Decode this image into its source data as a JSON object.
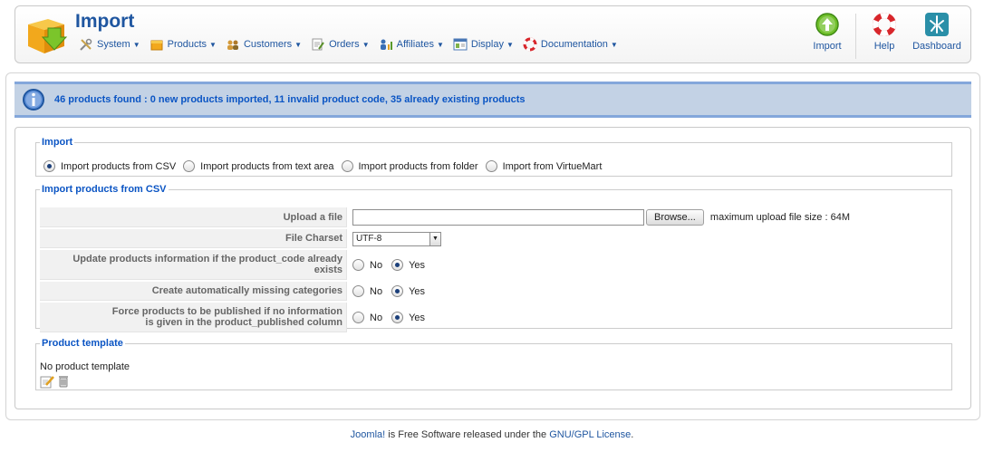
{
  "header": {
    "title": "Import",
    "menu": [
      {
        "label": "System",
        "icon": "wrench-screwdriver-icon"
      },
      {
        "label": "Products",
        "icon": "box-icon"
      },
      {
        "label": "Customers",
        "icon": "users-icon"
      },
      {
        "label": "Orders",
        "icon": "document-pen-icon"
      },
      {
        "label": "Affiliates",
        "icon": "people-chart-icon"
      },
      {
        "label": "Display",
        "icon": "window-icon"
      },
      {
        "label": "Documentation",
        "icon": "lifebuoy-icon"
      }
    ],
    "toolbar": {
      "import_label": "Import",
      "help_label": "Help",
      "dashboard_label": "Dashboard"
    }
  },
  "message": {
    "text": "46 products found : 0 new products imported, 11 invalid product code, 35 already existing products"
  },
  "import_section": {
    "legend": "Import",
    "options": [
      {
        "label": "Import products from CSV",
        "selected": true
      },
      {
        "label": "Import products from text area",
        "selected": false
      },
      {
        "label": "Import products from folder",
        "selected": false
      },
      {
        "label": "Import from VirtueMart",
        "selected": false
      }
    ]
  },
  "csv_section": {
    "legend": "Import products from CSV",
    "upload_label": "Upload a file",
    "browse_label": "Browse...",
    "max_size_text": "maximum upload file size : 64M",
    "charset_label": "File Charset",
    "charset_value": "UTF-8",
    "update_label": "Update products information if the product_code already exists",
    "create_cat_label": "Create automatically missing categories",
    "force_pub_label_1": "Force products to be published if no information",
    "force_pub_label_2": "is given in the product_published column",
    "no_label": "No",
    "yes_label": "Yes",
    "update_value": "Yes",
    "create_cat_value": "Yes",
    "force_pub_value": "Yes"
  },
  "template_section": {
    "legend": "Product template",
    "text": "No product template"
  },
  "footer": {
    "link1": "Joomla!",
    "middle": " is Free Software released under the ",
    "link2": "GNU/GPL License",
    "end": "."
  },
  "colors": {
    "link_blue": "#1f56a0",
    "message_bg": "#c3d2e5",
    "message_text": "#0b55c4"
  }
}
